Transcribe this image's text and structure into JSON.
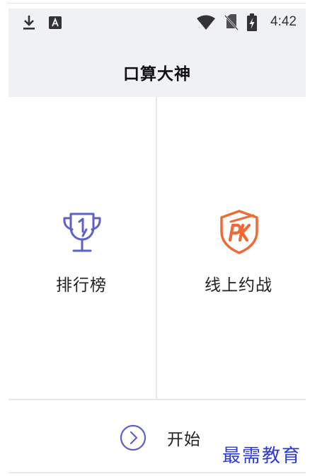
{
  "status_bar": {
    "time": "4:42",
    "icons": [
      "download-icon",
      "keyboard-a-icon",
      "wifi-icon",
      "no-sim-icon",
      "battery-charging-icon"
    ]
  },
  "header": {
    "title": "口算大神"
  },
  "panels": [
    {
      "label": "排行榜",
      "icon": "trophy-icon"
    },
    {
      "label": "线上约战",
      "icon": "pk-shield-icon"
    }
  ],
  "start": {
    "label": "开始",
    "icon": "chevron-right-circle-icon"
  },
  "watermark": "最需教育",
  "colors": {
    "header_bg": "#eff1f5",
    "trophy": "#5b61c9",
    "pk": "#f06a36",
    "start_icon": "#5b61c9",
    "watermark": "#2c3bd6"
  }
}
